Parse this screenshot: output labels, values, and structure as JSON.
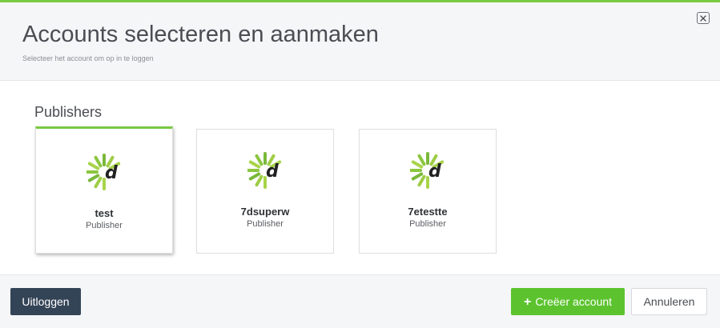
{
  "header": {
    "title": "Accounts selecteren en aanmaken",
    "subtitle": "Selecteer het account om op in te loggen",
    "close_icon": "close-icon"
  },
  "section": {
    "title": "Publishers"
  },
  "accounts": [
    {
      "name": "test",
      "role": "Publisher",
      "selected": true,
      "logo_icon": "daisycon-logo-icon"
    },
    {
      "name": "7dsuperw",
      "role": "Publisher",
      "selected": false,
      "logo_icon": "daisycon-logo-icon"
    },
    {
      "name": "7etestte",
      "role": "Publisher",
      "selected": false,
      "logo_icon": "daisycon-logo-icon"
    }
  ],
  "footer": {
    "logout_label": "Uitloggen",
    "create_icon": "plus-icon",
    "create_label": "Creëer account",
    "cancel_label": "Annuleren"
  },
  "colors": {
    "accent_green": "#7ac943",
    "create_button": "#5cc32e",
    "logout_button": "#344457"
  }
}
